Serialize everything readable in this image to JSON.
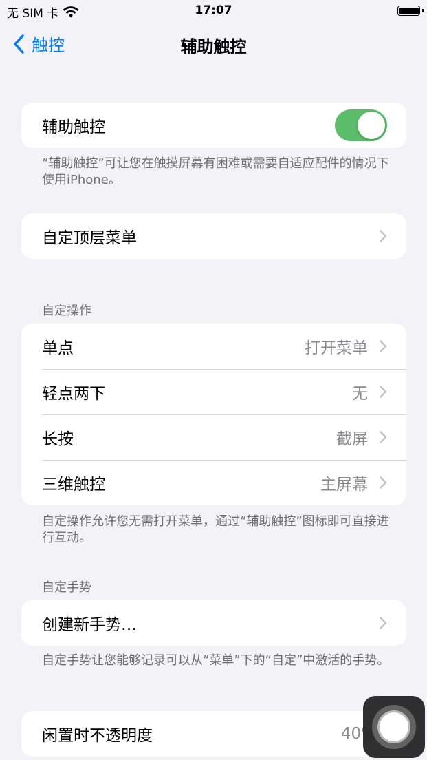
{
  "status": {
    "carrier": "无 SIM 卡",
    "time": "17:07"
  },
  "nav": {
    "back_label": "触控",
    "title": "辅助触控"
  },
  "main_toggle": {
    "label": "辅助触控",
    "on": true,
    "note": "“辅助触控”可让您在触摸屏幕有困难或需要自适应配件的情况下使用iPhone。"
  },
  "top_menu": {
    "label": "自定顶层菜单"
  },
  "custom_actions": {
    "header": "自定操作",
    "rows": [
      {
        "label": "单点",
        "value": "打开菜单"
      },
      {
        "label": "轻点两下",
        "value": "无"
      },
      {
        "label": "长按",
        "value": "截屏"
      },
      {
        "label": "三维触控",
        "value": "主屏幕"
      }
    ],
    "note": "自定操作允许您无需打开菜单，通过“辅助触控”图标即可直接进行互动。"
  },
  "custom_gestures": {
    "header": "自定手势",
    "create_label": "创建新手势…",
    "note": "自定手势让您能够记录可以从“菜单”下的“自定”中激活的手势。"
  },
  "idle_opacity": {
    "label": "闲置时不透明度",
    "value": "40%"
  },
  "colors": {
    "accent": "#007aff",
    "toggle_on": "#5bbd6a",
    "background": "#f2f2f7"
  }
}
